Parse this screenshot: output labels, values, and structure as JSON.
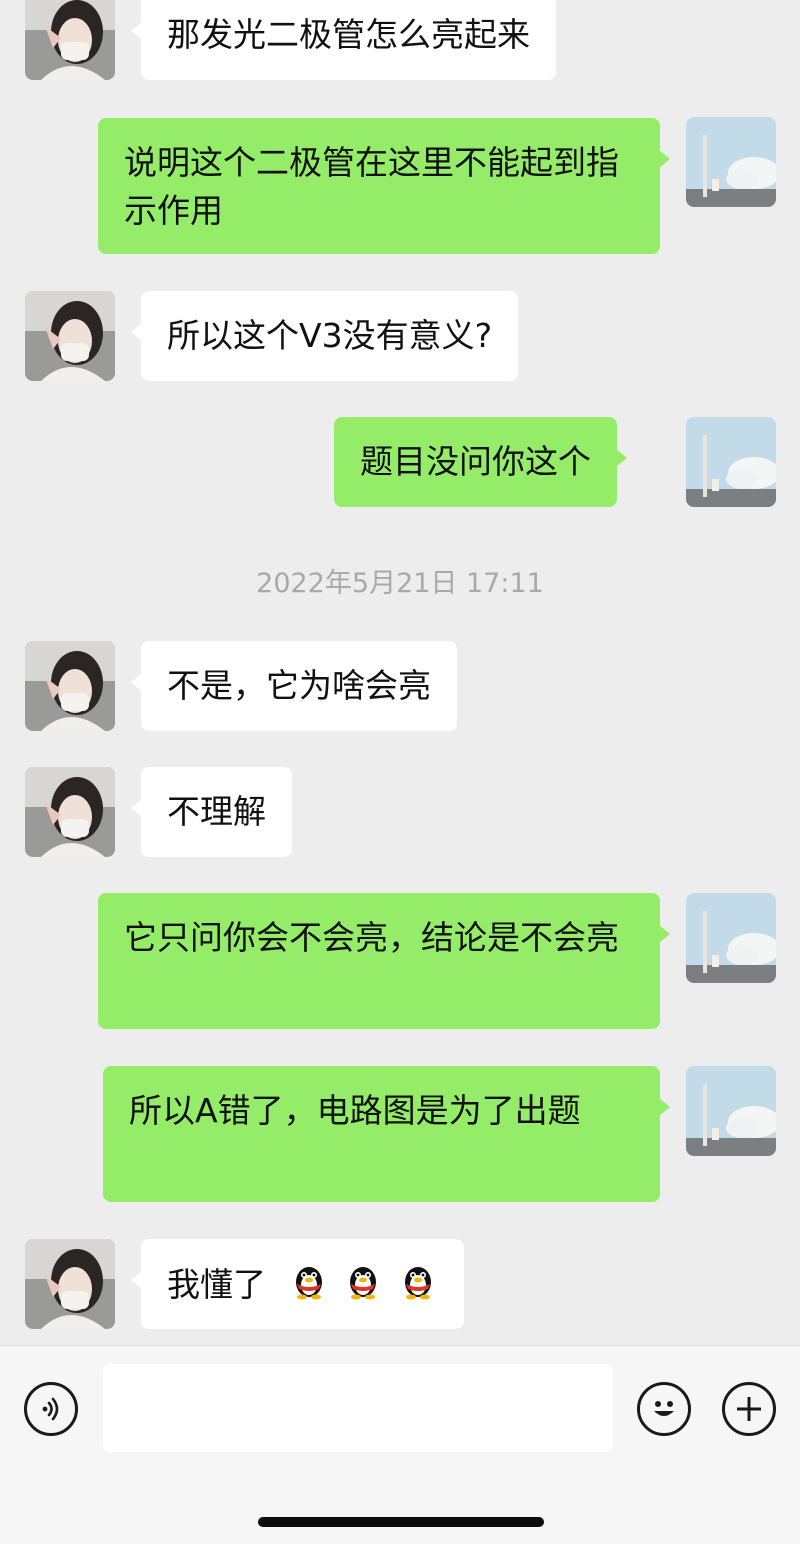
{
  "chat": {
    "messages": [
      {
        "sender": "other",
        "text": "那发光二极管怎么亮起来"
      },
      {
        "sender": "me",
        "text": "说明这个二极管在这里不能起到指示作用"
      },
      {
        "sender": "other",
        "text": "所以这个V3没有意义?"
      },
      {
        "sender": "me",
        "text": "题目没问你这个"
      },
      {
        "sender": "other",
        "text": "不是，它为啥会亮"
      },
      {
        "sender": "other",
        "text": "不理解"
      },
      {
        "sender": "me",
        "text": "它只问你会不会亮，结论是不会亮"
      },
      {
        "sender": "me",
        "text": "所以A错了，电路图是为了出题"
      },
      {
        "sender": "other",
        "text": "我懂了",
        "emoji": [
          "qq-penguin-emoji",
          "qq-penguin-emoji",
          "qq-penguin-emoji"
        ]
      }
    ],
    "timestamp": "2022年5月21日 17:11"
  },
  "input_bar": {
    "voice_icon": "voice-icon",
    "emoji_icon": "emoji-smile-icon",
    "plus_icon": "plus-icon",
    "input_value": ""
  },
  "colors": {
    "background": "#ededed",
    "my_bubble": "#95ec69",
    "other_bubble": "#ffffff",
    "timestamp_text": "#a9a9a9"
  }
}
